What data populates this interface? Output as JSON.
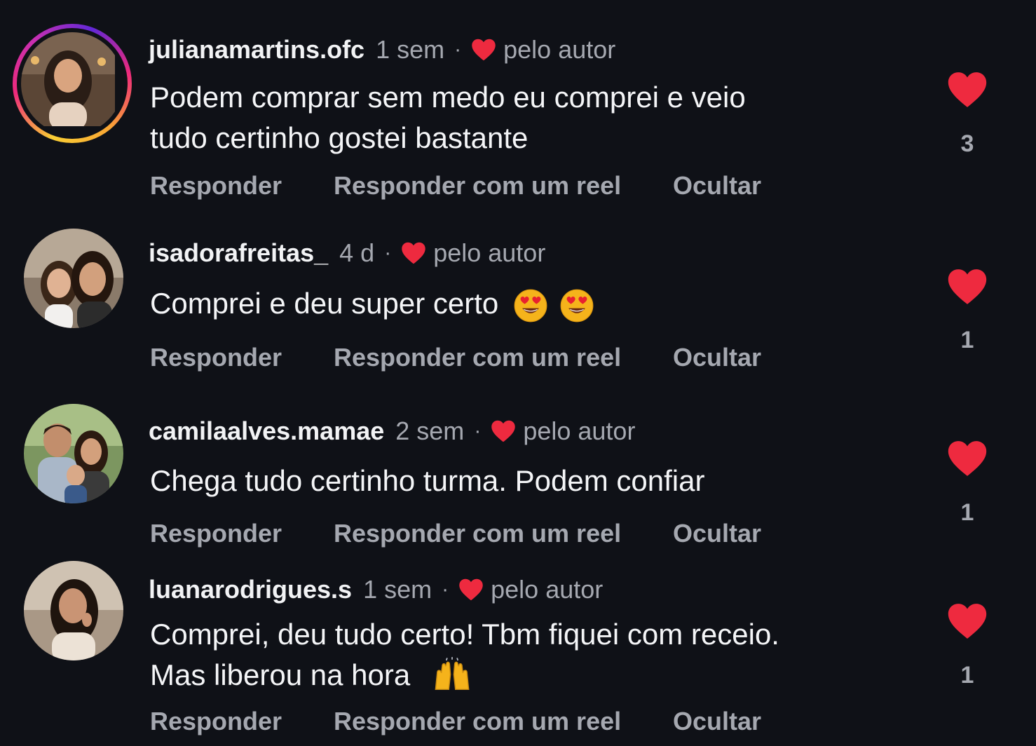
{
  "colors": {
    "background": "#0f1117",
    "heart": "#ee2a3f",
    "muted": "#a5a8b0",
    "text": "#f2f3f5"
  },
  "comments": [
    {
      "username": "julianamartins.ofc",
      "time": "1 sem",
      "separator": "·",
      "by_author": "pelo autor",
      "text_lines": [
        "Podem comprar sem medo eu comprei e veio",
        "tudo certinho gostei bastante"
      ],
      "actions": {
        "reply": "Responder",
        "reply_reel": "Responder com um reel",
        "hide": "Ocultar"
      },
      "likes": "3",
      "avatar": "woman-portrait-icon",
      "has_story_ring": true
    },
    {
      "username": "isadorafreitas_",
      "time": "4 d",
      "separator": "·",
      "by_author": "pelo autor",
      "text_lines": [
        "Comprei e deu super certo"
      ],
      "emojis": [
        "heart-eyes-emoji",
        "heart-eyes-emoji"
      ],
      "actions": {
        "reply": "Responder",
        "reply_reel": "Responder com um reel",
        "hide": "Ocultar"
      },
      "likes": "1",
      "avatar": "mother-daughter-portrait-icon",
      "has_story_ring": false
    },
    {
      "username": "camilaalves.mamae",
      "time": "2 sem",
      "separator": "·",
      "by_author": "pelo autor",
      "text_lines": [
        "Chega tudo certinho turma. Podem confiar"
      ],
      "actions": {
        "reply": "Responder",
        "reply_reel": "Responder com um reel",
        "hide": "Ocultar"
      },
      "likes": "1",
      "avatar": "family-portrait-icon",
      "has_story_ring": false
    },
    {
      "username": "luanarodrigues.s",
      "time": "1 sem",
      "separator": "·",
      "by_author": "pelo autor",
      "text_lines": [
        "Comprei, deu tudo certo! Tbm fiquei com receio.",
        "Mas liberou na hora"
      ],
      "emojis": [
        "raising-hands-emoji"
      ],
      "actions": {
        "reply": "Responder",
        "reply_reel": "Responder com um reel",
        "hide": "Ocultar"
      },
      "likes": "1",
      "avatar": "woman-portrait-icon",
      "has_story_ring": false
    }
  ]
}
